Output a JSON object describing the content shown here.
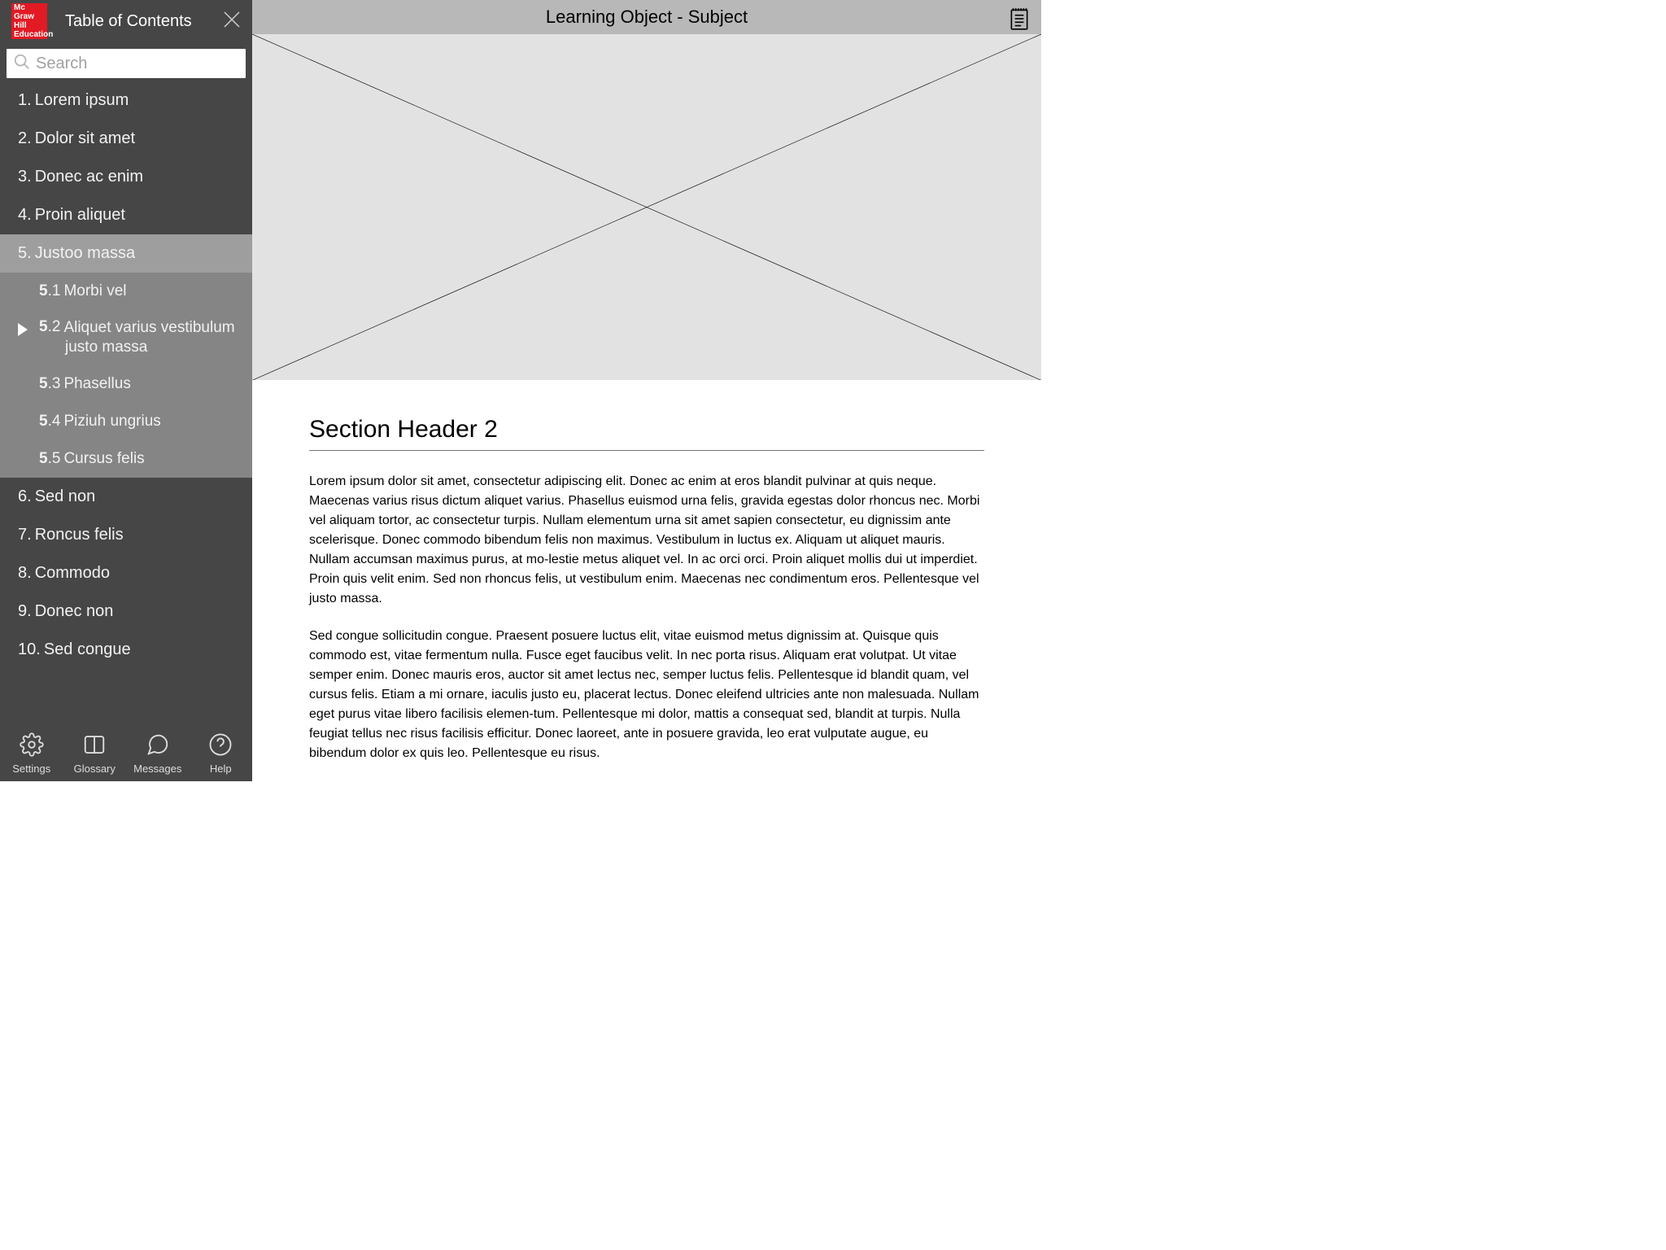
{
  "logo_text": "Mc\nGraw\nHill\nEducation",
  "sidebar_title": "Table of Contents",
  "search": {
    "placeholder": "Search"
  },
  "toc": [
    {
      "n": "1",
      "label": "Lorem ipsum"
    },
    {
      "n": "2",
      "label": "Dolor sit amet"
    },
    {
      "n": "3",
      "label": "Donec ac enim"
    },
    {
      "n": "4",
      "label": "Proin aliquet"
    },
    {
      "n": "5",
      "label": "Justoo massa",
      "active": true,
      "children": [
        {
          "n": "5.1",
          "label": "Morbi vel"
        },
        {
          "n": "5.2",
          "label": "Aliquet varius vestibulum justo massa",
          "current": true
        },
        {
          "n": "5.3",
          "label": "Phasellus"
        },
        {
          "n": "5.4",
          "label": "Piziuh ungrius"
        },
        {
          "n": "5.5",
          "label": "Cursus felis"
        }
      ]
    },
    {
      "n": "6",
      "label": "Sed non"
    },
    {
      "n": "7",
      "label": "Roncus felis"
    },
    {
      "n": "8",
      "label": "Commodo"
    },
    {
      "n": "9",
      "label": "Donec non"
    },
    {
      "n": "10",
      "label": "Sed congue"
    }
  ],
  "bottom": {
    "settings": "Settings",
    "glossary": "Glossary",
    "messages": "Messages",
    "help": "Help"
  },
  "main": {
    "top_title": "Learning Object - Subject",
    "section_header": "Section Header 2",
    "para1": "Lorem ipsum dolor sit amet, consectetur adipiscing elit. Donec ac enim at eros blandit pulvinar at quis neque. Maecenas varius risus dictum aliquet varius. Phasellus euismod urna felis, gravida egestas dolor rhoncus nec. Morbi vel aliquam tortor, ac consectetur turpis. Nullam elementum urna sit amet sapien consectetur, eu dignissim ante scelerisque. Donec commodo bibendum felis non maximus. Vestibulum in luctus ex. Aliquam ut aliquet mauris. Nullam accumsan maximus purus, at mo-lestie metus aliquet vel. In ac orci orci. Proin aliquet mollis dui ut imperdiet. Proin quis velit enim. Sed non rhoncus felis, ut vestibulum enim. Maecenas nec condimentum eros. Pellentesque vel justo massa.",
    "para2": "Sed congue sollicitudin congue. Praesent posuere luctus elit, vitae euismod metus dignissim at. Quisque quis commodo est, vitae fermentum nulla. Fusce eget faucibus velit. In nec porta risus. Aliquam erat volutpat. Ut vitae semper enim. Donec mauris eros, auctor sit amet lectus nec, semper luctus felis. Pellentesque id blandit quam, vel cursus felis. Etiam a mi ornare, iaculis justo eu, placerat lectus. Donec eleifend ultricies ante non malesuada. Nullam eget purus vitae libero facilisis elemen-tum. Pellentesque mi dolor, mattis a consequat sed, blandit at turpis. Nulla feugiat tellus nec risus facilisis efficitur. Donec laoreet, ante in posuere gravida, leo erat vulputate augue, eu bibendum dolor ex quis leo. Pellentesque eu risus."
  }
}
